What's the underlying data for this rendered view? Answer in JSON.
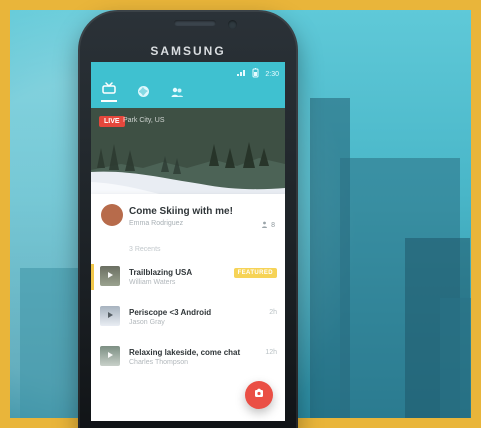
{
  "device": {
    "brand_label": "SAMSUNG"
  },
  "app": {
    "status_time": "2:30",
    "tabs": [
      {
        "id": "tv",
        "icon": "tv-icon",
        "active": true
      },
      {
        "id": "global",
        "icon": "globe-icon",
        "active": false
      },
      {
        "id": "people",
        "icon": "people-icon",
        "active": false
      }
    ],
    "featured_live": {
      "live_label": "LIVE",
      "location": "Park City, US",
      "title": "Come Skiing with me!",
      "user": "Emma Rodriguez",
      "viewers": "8"
    },
    "recents": {
      "header": "3 Recents",
      "items": [
        {
          "title": "Trailblazing USA",
          "user": "William Waters",
          "badge": "FEATURED",
          "time": "",
          "thumb_icon": "play-icon"
        },
        {
          "title": "Periscope <3 Android",
          "user": "Jason Gray",
          "badge": "",
          "time": "2h",
          "thumb_icon": "play-icon"
        },
        {
          "title": "Relaxing lakeside, come chat",
          "user": "Charles Thompson",
          "badge": "",
          "time": "12h",
          "thumb_icon": "play-icon"
        }
      ]
    },
    "fab": {
      "icon": "camera-icon"
    }
  },
  "colors": {
    "frame": "#e9b53a",
    "topbar": "#3fc1d0",
    "live": "#e5473c",
    "featured": "#f6d357",
    "fab": "#ea4f45"
  }
}
